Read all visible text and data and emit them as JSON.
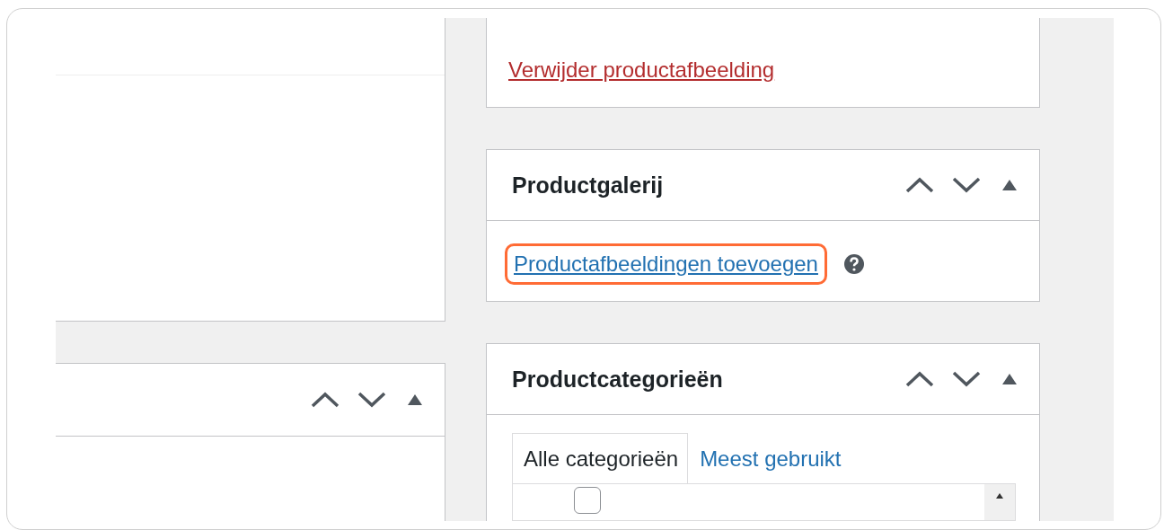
{
  "featured_image_box": {
    "remove_link": "Verwijder productafbeelding"
  },
  "gallery_box": {
    "title": "Productgalerij",
    "add_link": "Productafbeeldingen toevoegen",
    "highlighted": true
  },
  "categories_box": {
    "title": "Productcategorieën",
    "tabs": [
      {
        "label": "Alle categorieën",
        "selected": true
      },
      {
        "label": "Meest gebruikt",
        "selected": false
      }
    ],
    "list": [
      {
        "checked": false
      }
    ]
  }
}
